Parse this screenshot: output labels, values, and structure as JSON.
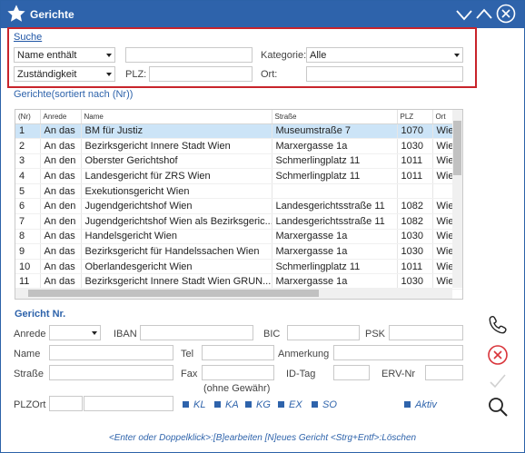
{
  "window": {
    "title": "Gerichte"
  },
  "search": {
    "section_label": "Suche",
    "filter_mode": "Name enthält",
    "filter_value": "",
    "kategorie_label": "Kategorie:",
    "kategorie_value": "Alle",
    "zustaendigkeit": "Zuständigkeit",
    "plz_label": "PLZ:",
    "plz_value": "",
    "ort_label": "Ort:",
    "ort_value": ""
  },
  "grid": {
    "title": "Gerichte(sortiert nach (Nr))",
    "columns": [
      "(Nr)",
      "Anrede",
      "Name",
      "Straße",
      "PLZ",
      "Ort"
    ],
    "rows": [
      [
        "1",
        "An das",
        "BM für Justiz",
        "Museumstraße 7",
        "1070",
        "Wie"
      ],
      [
        "2",
        "An das",
        "Bezirksgericht Innere Stadt Wien",
        "Marxergasse 1a",
        "1030",
        "Wie"
      ],
      [
        "3",
        "An den",
        "Oberster Gerichtshof",
        "Schmerlingplatz 11",
        "1011",
        "Wie"
      ],
      [
        "4",
        "An das",
        "Landesgericht für ZRS Wien",
        "Schmerlingplatz 11",
        "1011",
        "Wie"
      ],
      [
        "5",
        "An das",
        "Exekutionsgericht Wien",
        "",
        "",
        ""
      ],
      [
        "6",
        "An den",
        "Jugendgerichtshof Wien",
        "Landesgerichtsstraße 11",
        "1082",
        "Wie"
      ],
      [
        "7",
        "An den",
        "Jugendgerichtshof Wien als Bezirksgeric...",
        "Landesgerichtsstraße 11",
        "1082",
        "Wie"
      ],
      [
        "8",
        "An das",
        "Handelsgericht Wien",
        "Marxergasse 1a",
        "1030",
        "Wie"
      ],
      [
        "9",
        "An das",
        "Bezirksgericht für Handelssachen Wien",
        "Marxergasse 1a",
        "1030",
        "Wie"
      ],
      [
        "10",
        "An das",
        "Oberlandesgericht Wien",
        "Schmerlingplatz 11",
        "1011",
        "Wie"
      ],
      [
        "11",
        "An das",
        "Bezirksgericht Innere Stadt Wien GRUN...",
        "Marxergasse 1a",
        "1030",
        "Wie"
      ]
    ]
  },
  "detail": {
    "section_title": "Gericht Nr.",
    "anrede_label": "Anrede",
    "iban_label": "IBAN",
    "bic_label": "BIC",
    "psk_label": "PSK",
    "name_label": "Name",
    "tel_label": "Tel",
    "anmerkung_label": "Anmerkung",
    "strasse_label": "Straße",
    "fax_label": "Fax",
    "fax_hint": "(ohne Gewähr)",
    "idtag_label": "ID-Tag",
    "ervnr_label": "ERV-Nr",
    "plzort_label": "PLZOrt",
    "checks": [
      "KL",
      "KA",
      "KG",
      "EX",
      "SO"
    ],
    "aktiv_label": "Aktiv"
  },
  "footer": "<Enter oder Doppelklick>:[B]earbeiten  [N]eues Gericht  <Strg+Entf>:Löschen",
  "icons": [
    "star-icon",
    "chevron-down-icon",
    "chevron-up-icon",
    "close-icon",
    "phone-icon",
    "cancel-icon",
    "check-icon",
    "search-icon"
  ],
  "colors": {
    "titlebar": "#2e63ab",
    "accent": "#2e63ab",
    "highlight_border": "#c8242b",
    "selected_row": "#cce4f7",
    "cancel": "#d9343a"
  }
}
